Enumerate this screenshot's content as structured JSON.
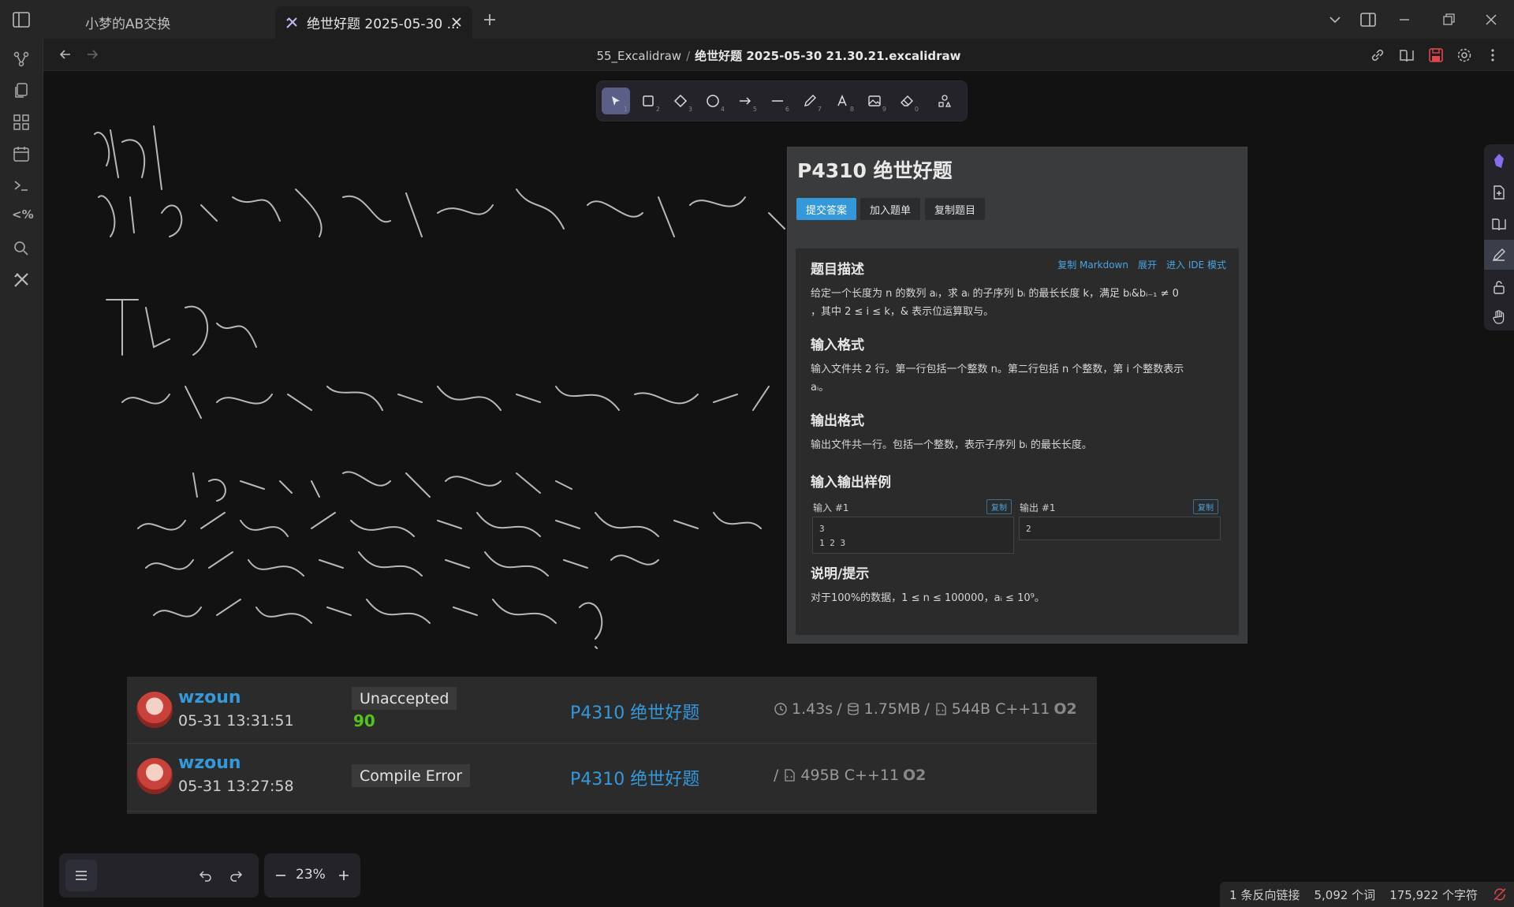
{
  "tabs": [
    {
      "label": "小梦的AB交换"
    },
    {
      "label": "绝世好题 2025-05-30 ..."
    }
  ],
  "breadcrumb": {
    "folder": "55_Excalidraw",
    "sep": "/",
    "file": "绝世好题 2025-05-30 21.30.21.excalidraw"
  },
  "toolbar": {
    "tools": [
      "selection",
      "rectangle",
      "diamond",
      "ellipse",
      "arrow",
      "line",
      "draw",
      "text",
      "image",
      "eraser",
      "more-tools"
    ],
    "numbers": [
      "1",
      "2",
      "3",
      "4",
      "5",
      "6",
      "7",
      "8",
      "9",
      "0"
    ]
  },
  "handwriting": {
    "note": "handwritten strokes (illegible ink)"
  },
  "problem": {
    "title": "P4310 绝世好题",
    "buttons": {
      "submit": "提交答案",
      "add": "加入题单",
      "copy": "复制题目"
    },
    "links": {
      "copy_md": "复制 Markdown",
      "expand": "展开",
      "ide": "进入 IDE 模式"
    },
    "desc_title": "题目描述",
    "desc_text_1": "给定一个长度为 n 的数列 aᵢ，求 aᵢ 的子序列 bᵢ 的最长长度 k，满足 bᵢ&bᵢ₋₁ ≠ 0",
    "desc_text_2": "，其中 2 ≤ i ≤ k，& 表示位运算取与。",
    "input_title": "输入格式",
    "input_text_1": "输入文件共 2 行。第一行包括一个整数 n。第二行包括 n 个整数，第 i 个整数表示",
    "input_text_2": "aᵢ。",
    "output_title": "输出格式",
    "output_text": "输出文件共一行。包括一个整数，表示子序列 bᵢ 的最长长度。",
    "sample_title": "输入输出样例",
    "input_label": "输入 #1",
    "output_label": "输出 #1",
    "copy_label": "复制",
    "sample_input_1": "3",
    "sample_input_2": "1 2 3",
    "sample_output": "2",
    "hint_title": "说明/提示",
    "hint_text": "对于100%的数据，1 ≤ n ≤ 100000，aᵢ ≤ 10⁹。"
  },
  "records": [
    {
      "user": "wzoun",
      "time": "05-31 13:31:51",
      "status": "Unaccepted",
      "score": "90",
      "problem": "P4310 绝世好题",
      "meta_time": "1.43s",
      "meta_mem": "1.75MB",
      "meta_code": "544B C++11",
      "o2": "O2"
    },
    {
      "user": "wzoun",
      "time": "05-31 13:27:58",
      "status": "Compile Error",
      "problem": "P4310 绝世好题",
      "meta_code": "495B C++11",
      "o2": "O2"
    }
  ],
  "zoom": {
    "value": "23%"
  },
  "statusbar": {
    "backlinks": "1 条反向链接",
    "words": "5,092 个词",
    "chars": "175,922 个字符"
  },
  "colors": {
    "accent": "#3498db",
    "success": "#52c41a",
    "tool_active": "#5b5f87"
  }
}
